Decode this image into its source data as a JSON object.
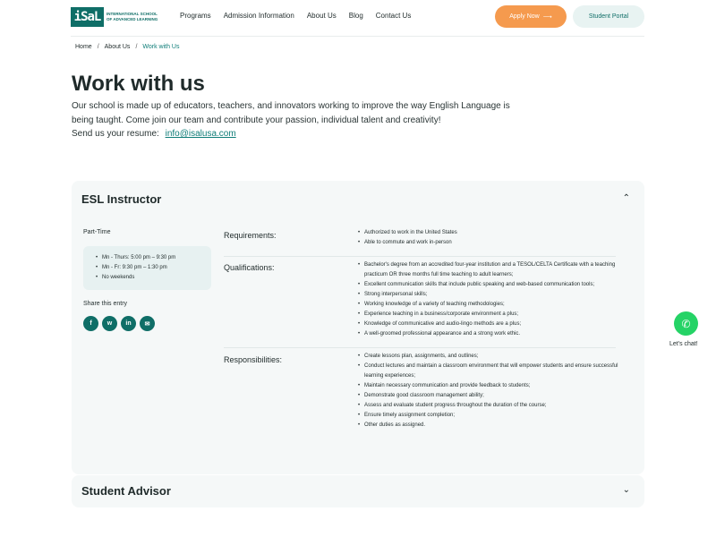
{
  "logo": {
    "mark": "iSaL",
    "text_line1": "INTERNATIONAL SCHOOL",
    "text_line2": "OF ADVANCED LEARNING"
  },
  "nav": [
    "Programs",
    "Admission Information",
    "About Us",
    "Blog",
    "Contact Us"
  ],
  "buttons": {
    "apply": "Apply Now",
    "apply_arrow": "⟶",
    "portal": "Student Portal"
  },
  "breadcrumb": {
    "home": "Home",
    "about": "About Us",
    "current": "Work with Us",
    "sep": "/"
  },
  "hero": {
    "title": "Work with us",
    "intro": "Our school is made up of educators, teachers, and innovators working to improve the way English Language is being taught. Come join our team and contribute your passion, individual talent and creativity!",
    "resume_label": "Send us your resume:",
    "email": "info@isalusa.com"
  },
  "job1": {
    "title": "ESL Instructor",
    "chevron": "⌃",
    "type": "Part-Time",
    "schedule": [
      "Mn - Thurs: 5:00 pm – 9:30 pm",
      "Mn - Fr: 9:30 pm – 1:30 pm",
      "No weekends"
    ],
    "share_label": "Share this entry",
    "share_icons": [
      "f",
      "w",
      "in",
      "✉"
    ],
    "requirements_label": "Requirements:",
    "requirements": [
      "Authorized to work in the United States",
      "Able to commute and work in-person"
    ],
    "qualifications_label": "Qualifications:",
    "qualifications": [
      "Bachelor's degree from an accredited four-year institution and a TESOL/CELTA Certificate with a teaching practicum OR three months full time teaching to adult learners;",
      "Excellent communication skills that include public speaking and web-based communication tools;",
      "Strong interpersonal skills;",
      "Working knowledge of a variety of teaching methodologies;",
      "Experience teaching in a business/corporate environment a plus;",
      "Knowledge of communicative and audio-lingo methods are a plus;",
      "A well-groomed professional appearance and a strong work ethic."
    ],
    "responsibilities_label": "Responsibilities:",
    "responsibilities": [
      "Create lessons plan, assignments, and outlines;",
      "Conduct lectures and maintain a classroom environment that will empower students and ensure successful learning experiences;",
      "Maintain necessary communication and provide feedback to students;",
      "Demonstrate good classroom management ability;",
      "Assess and evaluate student progress throughout the duration of the course;",
      "Ensure timely assignment completion;",
      "Other duties as assigned."
    ]
  },
  "job2": {
    "title": "Student Advisor",
    "chevron": "⌄"
  },
  "chat": {
    "label": "Let's chat!",
    "icon": "✆"
  }
}
